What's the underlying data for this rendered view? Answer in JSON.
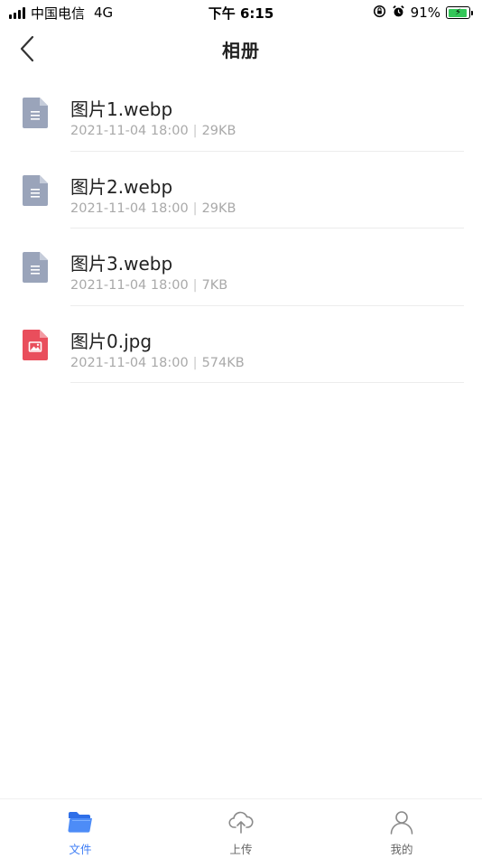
{
  "status_bar": {
    "carrier": "中国电信",
    "network": "4G",
    "time": "下午 6:15",
    "battery": "91%",
    "battery_level": 0.91,
    "battery_color": "#34c759"
  },
  "nav": {
    "title": "相册",
    "back_icon": "chevron-left-icon"
  },
  "files": [
    {
      "name": "图片1.webp",
      "date": "2021-11-04 18:00",
      "size": "29KB",
      "icon": "document-file-icon",
      "icon_color": "#9aa4ba"
    },
    {
      "name": "图片2.webp",
      "date": "2021-11-04 18:00",
      "size": "29KB",
      "icon": "document-file-icon",
      "icon_color": "#9aa4ba"
    },
    {
      "name": "图片3.webp",
      "date": "2021-11-04 18:00",
      "size": "7KB",
      "icon": "document-file-icon",
      "icon_color": "#9aa4ba"
    },
    {
      "name": "图片0.jpg",
      "date": "2021-11-04 18:00",
      "size": "574KB",
      "icon": "image-file-icon",
      "icon_color": "#e94e5c"
    }
  ],
  "tabs": [
    {
      "label": "文件",
      "icon": "folder-icon",
      "active": true
    },
    {
      "label": "上传",
      "icon": "cloud-upload-icon",
      "active": false
    },
    {
      "label": "我的",
      "icon": "user-icon",
      "active": false
    }
  ],
  "colors": {
    "accent": "#3c7cf5",
    "meta_text": "#a9a9a9",
    "divider": "#ececec"
  }
}
